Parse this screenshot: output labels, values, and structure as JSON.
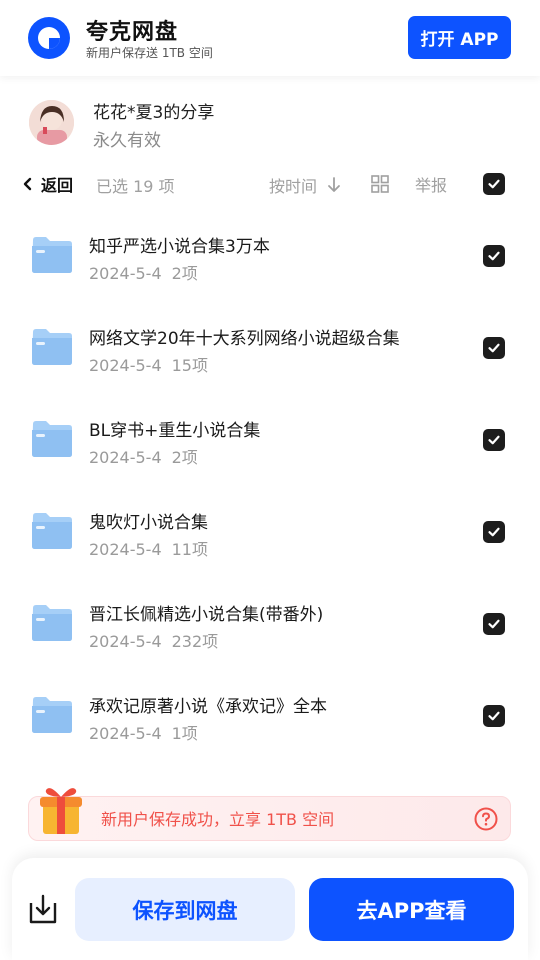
{
  "header": {
    "brand_name": "夸克网盘",
    "brand_subtitle": "新用户保存送 1TB 空间",
    "open_app_label": "打开 APP"
  },
  "share": {
    "title": "花花*夏3的分享",
    "validity": "永久有效"
  },
  "toolbar": {
    "back_label": "返回",
    "selected_count": "已选 19 项",
    "sort_label": "按时间",
    "report_label": "举报",
    "select_all_checked": true
  },
  "files": [
    {
      "name": "知乎严选小说合集3万本",
      "date": "2024-5-4",
      "count": "2项",
      "checked": true
    },
    {
      "name": "网络文学20年十大系列网络小说超级合集",
      "date": "2024-5-4",
      "count": "15项",
      "checked": true
    },
    {
      "name": "BL穿书+重生小说合集",
      "date": "2024-5-4",
      "count": "2项",
      "checked": true
    },
    {
      "name": "鬼吹灯小说合集",
      "date": "2024-5-4",
      "count": "11项",
      "checked": true
    },
    {
      "name": "晋江长佩精选小说合集(带番外)",
      "date": "2024-5-4",
      "count": "232项",
      "checked": true
    },
    {
      "name": "承欢记原著小说《承欢记》全本",
      "date": "2024-5-4",
      "count": "1项",
      "checked": true
    }
  ],
  "promo": {
    "text": "新用户保存成功，立享 1TB 空间"
  },
  "bottom": {
    "save_label": "保存到网盘",
    "app_label": "去APP查看"
  },
  "colors": {
    "accent": "#0d53ff",
    "promo_text": "#f0514a",
    "folder": "#9cc9f7"
  },
  "icons": [
    "quark-logo-icon",
    "back-chevron-icon",
    "sort-down-arrow-icon",
    "grid-view-icon",
    "checkbox-checked-icon",
    "folder-icon",
    "gift-icon",
    "help-circle-icon",
    "download-icon"
  ]
}
